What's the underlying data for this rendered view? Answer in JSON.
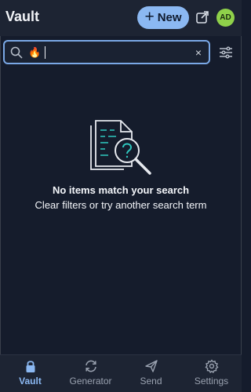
{
  "header": {
    "title": "Vault",
    "new_label": "New",
    "new_icon": "plus-icon",
    "popout_icon": "popout-icon",
    "avatar_initials": "AD",
    "avatar_color": "#8fd14a"
  },
  "search": {
    "value": "🔥",
    "placeholder": "",
    "clear_label": "×",
    "search_icon": "search-icon",
    "filter_icon": "filter-sliders-icon"
  },
  "empty_state": {
    "illustration": "document-search-icon",
    "title": "No items match your search",
    "subtitle": "Clear filters or try another search term"
  },
  "nav": {
    "items": [
      {
        "label": "Vault",
        "icon": "lock-icon",
        "active": true
      },
      {
        "label": "Generator",
        "icon": "refresh-icon",
        "active": false
      },
      {
        "label": "Send",
        "icon": "send-icon",
        "active": false
      },
      {
        "label": "Settings",
        "icon": "gear-icon",
        "active": false
      }
    ]
  },
  "colors": {
    "accent": "#8bb8f2",
    "background": "#151c2c",
    "surface": "#1d2433",
    "illustration_accent": "#2fc9c0"
  }
}
